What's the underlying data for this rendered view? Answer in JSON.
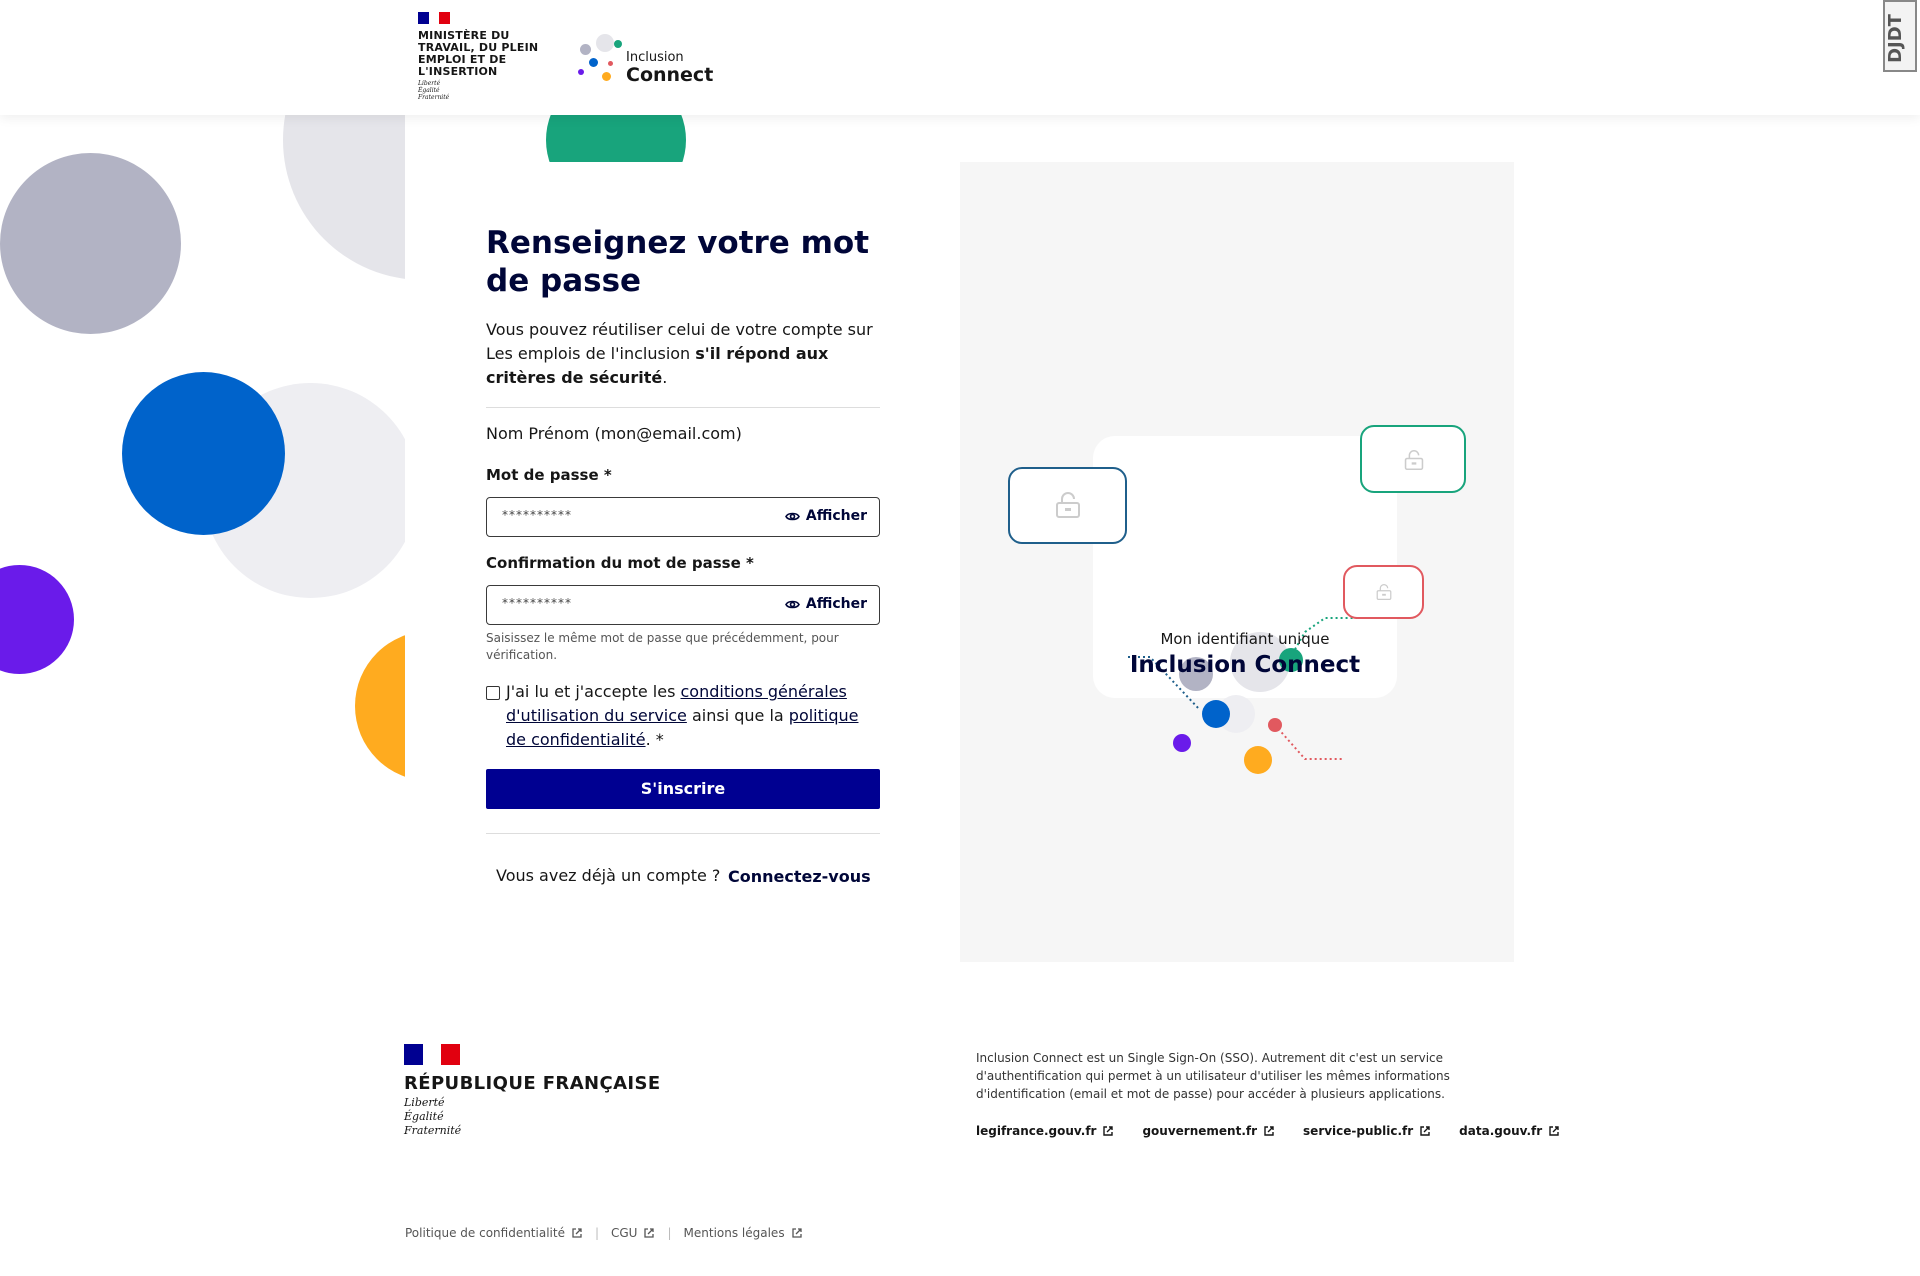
{
  "header": {
    "ministry_name": "MINISTÈRE DU TRAVAIL, DU PLEIN EMPLOI ET DE L'INSERTION",
    "ministry_motto": [
      "Liberté",
      "Égalité",
      "Fraternité"
    ],
    "app_logo_small": "Inclusion",
    "app_logo_big": "Connect",
    "extension_badge": "DJDT"
  },
  "form": {
    "title": "Renseignez votre mot de passe",
    "intro_plain": "Vous pouvez réutiliser celui de votre compte sur Les emplois de l'inclusion ",
    "intro_bold": "s'il répond aux critères de sécurité",
    "intro_end": ".",
    "user_identity": "Nom Prénom (mon@email.com)",
    "password_label": "Mot de passe *",
    "password_placeholder": "**********",
    "show_label": "Afficher",
    "confirm_label": "Confirmation du mot de passe *",
    "confirm_placeholder": "**********",
    "confirm_hint": "Saisissez le même mot de passe que précédemment, pour vérification.",
    "cgu_text_1": "J'ai lu et j'accepte les ",
    "cgu_link_1": "conditions générales d'utilisation du service",
    "cgu_text_2": " ainsi que la ",
    "cgu_link_2": "politique de confidentialité",
    "cgu_text_3": ". *",
    "submit_label": "S'inscrire",
    "already_account": "Vous avez déjà un compte ?",
    "connect_link": "Connectez-vous"
  },
  "illustration": {
    "caption_small": "Mon identifiant unique",
    "caption_big": "Inclusion Connect"
  },
  "footer": {
    "rf_name": "RÉPUBLIQUE FRANÇAISE",
    "rf_motto": [
      "Liberté",
      "Égalité",
      "Fraternité"
    ],
    "description": "Inclusion Connect est un Single Sign-On (SSO). Autrement dit c'est un service d'authentification qui permet à un utilisateur d'utiliser les mêmes informations d'identification (email et mot de passe) pour accéder à plusieurs applications.",
    "links": [
      "legifrance.gouv.fr",
      "gouvernement.fr",
      "service-public.fr",
      "data.gouv.fr"
    ],
    "bottom_links": [
      "Politique de confidentialité",
      "CGU",
      "Mentions légales"
    ]
  },
  "colors": {
    "primary": "#000091",
    "title": "#000638",
    "deco_grey": "#b2b3c4",
    "deco_blue": "#0063cb",
    "deco_purple": "#6a1bea",
    "deco_orange": "#ffab1f",
    "deco_green": "#18a47c"
  }
}
